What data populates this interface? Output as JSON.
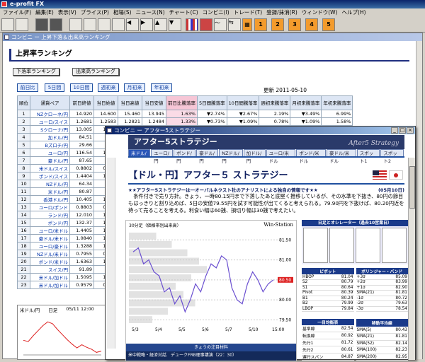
{
  "app": {
    "title": "e-profit FX"
  },
  "menu": [
    "ファイル(F)",
    "編集(E)",
    "表示(V)",
    "プライス(P)",
    "相場(S)",
    "ニュース(N)",
    "チャート(C)",
    "コンビニ(I)",
    "トレード(T)",
    "登録/抹消(R)",
    "ウィンドウ(W)",
    "ヘルプ(H)"
  ],
  "toolbar_numbers": [
    "1",
    "2",
    "3",
    "4",
    "5"
  ],
  "window1": {
    "title": "コンビニ ー 上昇下落＆出来高ランキング",
    "page_title": "上昇率ランキング",
    "btn_down": "下落率ランキング",
    "btn_volume": "出来高ランキング",
    "periods": [
      "前日比",
      "5日間",
      "10日間",
      "週初来",
      "月初来",
      "年初来"
    ],
    "update": "更新 2011-05-10",
    "headers": [
      "順位",
      "通貨ペア",
      "前日終値",
      "当日始値",
      "当日高値",
      "当日安値",
      "前日比騰落率",
      "5日間騰落率",
      "10日間騰落率",
      "週初来騰落率",
      "月初来騰落率",
      "年初来騰落率"
    ],
    "rows": [
      [
        "1",
        "NZクローネ/円",
        "14.920",
        "14.600",
        "15.460",
        "13.945",
        "1.63%",
        "▼2.74%",
        "▼2.67%",
        "2.19%",
        "▼3.49%",
        "6.99%"
      ],
      [
        "2",
        "ユーロ/スイス",
        "1.2681",
        "1.2583",
        "1.2821",
        "1.2484",
        "1.33%",
        "▼0.73%",
        "▼1.09%",
        "0.78%",
        "▼1.09%",
        "1.58%"
      ],
      [
        "3",
        "Sクローナ/円",
        "13.005",
        "12.80",
        "",
        "",
        "",
        "",
        "",
        "",
        "",
        ""
      ],
      [
        "4",
        "加ドル/円",
        "84.51",
        "83.3",
        "",
        "",
        "",
        "",
        "",
        "",
        "",
        ""
      ],
      [
        "5",
        "Bズロチ/円",
        "29.66",
        "29.3",
        "",
        "",
        "",
        "",
        "",
        "",
        "",
        ""
      ],
      [
        "6",
        "ユーロ/円",
        "116.54",
        "115.6",
        "",
        "",
        "",
        "",
        "",
        "",
        "",
        ""
      ],
      [
        "7",
        "豪ドル/円",
        "87.65",
        "86.1",
        "",
        "",
        "",
        "",
        "",
        "",
        "",
        ""
      ],
      [
        "8",
        "米ドル/スイス",
        "0.8802",
        "0.877",
        "",
        "",
        "",
        "",
        "",
        "",
        "",
        ""
      ],
      [
        "9",
        "ポンド/スイス",
        "1.4404",
        "1.438",
        "",
        "",
        "",
        "",
        "",
        "",
        "",
        ""
      ],
      [
        "10",
        "NZドル/円",
        "64.34",
        "63.7",
        "",
        "",
        "",
        "",
        "",
        "",
        "",
        ""
      ],
      [
        "11",
        "米ドル/円",
        "80.87",
        "80.5",
        "",
        "",
        "",
        "",
        "",
        "",
        "",
        ""
      ],
      [
        "12",
        "香港ドル/円",
        "10.405",
        "10.36",
        "",
        "",
        "",
        "",
        "",
        "",
        "",
        ""
      ],
      [
        "13",
        "ユーロ/ポンド",
        "0.8803",
        "0.675",
        "",
        "",
        "",
        "",
        "",
        "",
        "",
        ""
      ],
      [
        "14",
        "ランド/円",
        "12.010",
        "12.03",
        "",
        "",
        "",
        "",
        "",
        "",
        "",
        ""
      ],
      [
        "15",
        "ポンド/円",
        "132.37",
        "132.1",
        "",
        "",
        "",
        "",
        "",
        "",
        "",
        ""
      ],
      [
        "16",
        "ユーロ/米ドル",
        "1.4405",
        "1.433",
        "",
        "",
        "",
        "",
        "",
        "",
        "",
        ""
      ],
      [
        "17",
        "豪ドル/米ドル",
        "1.0840",
        "1.068",
        "",
        "",
        "",
        "",
        "",
        "",
        "",
        ""
      ],
      [
        "18",
        "ユーロ/豪ドル",
        "1.3288",
        "1.341",
        "",
        "",
        "",
        "",
        "",
        "",
        "",
        ""
      ],
      [
        "19",
        "NZドル/米ドル",
        "0.7955",
        "0.790",
        "",
        "",
        "",
        "",
        "",
        "",
        "",
        ""
      ],
      [
        "20",
        "ポンド/米ドル",
        "1.6363",
        "1.638",
        "",
        "",
        "",
        "",
        "",
        "",
        "",
        ""
      ],
      [
        "21",
        "スイス/円",
        "91.89",
        "91.8",
        "",
        "",
        "",
        "",
        "",
        "",
        "",
        ""
      ],
      [
        "22",
        "米ドル/加ドル",
        "1.5095",
        "1.533",
        "",
        "",
        "",
        "",
        "",
        "",
        "",
        ""
      ],
      [
        "23",
        "米ドル/加ドル",
        "0.9579",
        "0.967",
        "",
        "",
        "",
        "",
        "",
        "",
        "",
        ""
      ]
    ],
    "mini_chart": {
      "pair": "米ドル/円",
      "frame": "日足",
      "date": "05/11 12:00"
    }
  },
  "window2": {
    "title": "コンビニ ー アフター5ストラテジー",
    "banner": "アフター5ストラテジー",
    "banner_logo": "After5 Strategy",
    "tabs": [
      "米ドル/円",
      "ユーロ/円",
      "ポンド/円",
      "豪ドル/円",
      "NZドル/円",
      "加ドル/円",
      "ユーロ/米ドル",
      "ポンド/米ドル",
      "豪ドル/米ドル",
      "スポット1",
      "スポット2"
    ],
    "heading": "【ドル・円】アフター５ ストラテジー",
    "subline_left": "★★アフター5ストラテジーは一オーバルネクスト社のアナリストによる独自の情報です★★",
    "subline_right": "(05月10日)",
    "body": "　条件付きで売り方針。きょう、一時80.15円まで下落したあと底堅く推移しているが、その水準を下抜き、80円の節目もはっきりと割り込めば、5日の安値79.55円を試す可能性が出てくると考えられる。79.90円を下抜けば、80.20円近を待って売ることを考える。利食い幅は60銭、損切り幅は30銭で考えたい。",
    "chart_title": "30分足（価格帯別出来高）",
    "chart_logo": "Win·Station",
    "chart_price_tag": "80.50",
    "chart_footer_title": "きょうの注目材料",
    "chart_footer_text": "米中戦略・経済対話　デュークFRB理事講演（22：30）",
    "side_header": "日足とオシレーター（過去10営業日）",
    "mini_labels": [
      "ストキャ",
      "RSI(14)",
      "STOS(3,3)",
      "MACD"
    ],
    "pivot": {
      "title": "ピボット",
      "rows": [
        [
          "HBOP",
          "81.04"
        ],
        [
          "S2",
          "80.79"
        ],
        [
          "S1",
          "80.64"
        ],
        [
          "Pivot",
          "80.39"
        ],
        [
          "B1",
          "80.24"
        ],
        [
          "B2",
          "79.99"
        ],
        [
          "LBOP",
          "79.84"
        ]
      ]
    },
    "bollinger": {
      "title": "ボリンジャー・バンド",
      "rows": [
        [
          "+3σ",
          "85.09"
        ],
        [
          "+2σ",
          "83.99"
        ],
        [
          "+1σ",
          "82.90"
        ],
        [
          "SMA(21)",
          "81.81"
        ],
        [
          "-1σ",
          "80.72"
        ],
        [
          "-2σ",
          "79.63"
        ],
        [
          "-3σ",
          "78.54"
        ]
      ]
    },
    "balance": {
      "title": "一目均衡表",
      "rows": [
        [
          "基準線",
          "82.54"
        ],
        [
          "転換線",
          "80.92"
        ],
        [
          "先行1",
          "81.72"
        ],
        [
          "先行2",
          "80.61"
        ],
        [
          "遅行スパン",
          "84.87"
        ]
      ]
    },
    "moving": {
      "title": "移動平均線",
      "rows": [
        [
          "SMA(5)",
          "80.43"
        ],
        [
          "SMA(21)",
          "81.81"
        ],
        [
          "SMA(52)",
          "82.14"
        ],
        [
          "SMA(100)",
          "82.23"
        ],
        [
          "SMA(200)",
          "82.95"
        ]
      ]
    }
  },
  "chart_data": [
    {
      "type": "line",
      "title": "30分足（価格帯別出来高）",
      "x": [
        "5/3",
        "5/4",
        "5/5",
        "5/6",
        "5/7",
        "5/10",
        "15:00"
      ],
      "y_ticks": [
        79.5,
        80.0,
        80.5,
        81.0,
        81.5
      ],
      "series": [
        {
          "values": [
            81.2,
            81.3,
            80.9,
            81.0,
            80.7,
            80.6,
            80.2,
            80.3,
            79.9,
            80.1,
            79.7,
            80.0,
            80.4,
            80.2,
            80.6,
            80.9,
            80.8,
            81.1,
            81.0,
            80.3,
            80.0,
            79.9,
            80.4,
            80.7,
            80.5,
            80.2,
            80.4,
            80.5
          ]
        }
      ],
      "ylim": [
        79.4,
        81.7
      ],
      "volume_profile": [
        0.35,
        0.55,
        0.75,
        0.9,
        1.0,
        0.8,
        0.6,
        0.7,
        0.85,
        0.5,
        0.3
      ]
    },
    {
      "type": "line",
      "title": "米ドル/円 日足",
      "values": [
        82.3,
        82.1,
        83.0,
        83.8,
        84.6,
        85.2,
        84.9,
        84.0,
        83.2,
        82.4,
        81.7,
        81.1,
        81.6,
        81.2,
        80.9,
        80.4,
        80.6
      ],
      "ylim": [
        80,
        86
      ]
    }
  ]
}
